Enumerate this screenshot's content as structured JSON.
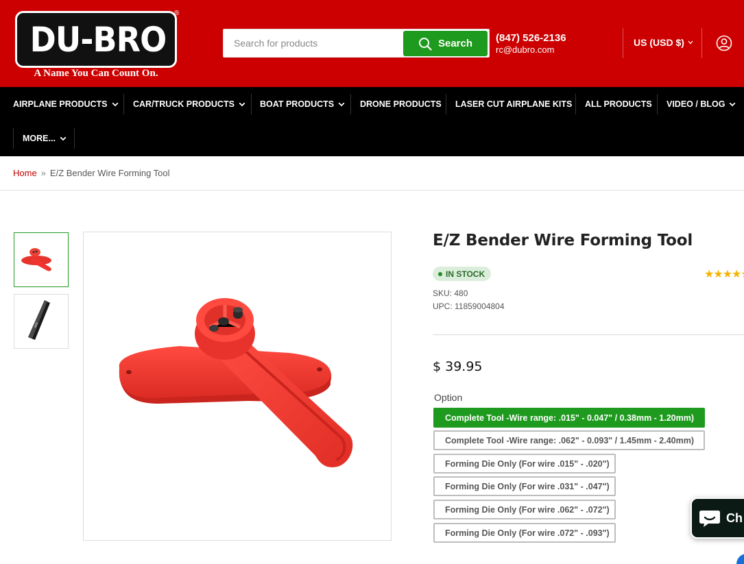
{
  "brand": {
    "logo_text": "DU-BRO",
    "registered": "®",
    "tagline": "A Name You Can Count On."
  },
  "search": {
    "placeholder": "Search for products",
    "button_label": "Search"
  },
  "contact": {
    "phone": "(847) 526-2136",
    "email": "rc@dubro.com"
  },
  "currency": {
    "label": "US (USD $)"
  },
  "nav": {
    "items": [
      {
        "label": "AIRPLANE PRODUCTS"
      },
      {
        "label": "CAR/TRUCK PRODUCTS"
      },
      {
        "label": "BOAT PRODUCTS"
      },
      {
        "label": "DRONE PRODUCTS"
      },
      {
        "label": "LASER CUT AIRPLANE KITS"
      },
      {
        "label": "ALL PRODUCTS"
      },
      {
        "label": "VIDEO / BLOG"
      },
      {
        "label": "MORE..."
      }
    ]
  },
  "breadcrumb": {
    "home": "Home",
    "separator": "»",
    "current": "E/Z Bender Wire Forming Tool"
  },
  "product": {
    "title": "E/Z Bender Wire Forming Tool",
    "stock": "IN STOCK",
    "stars": "★★★★★",
    "sku": "SKU: 480",
    "upc": "UPC: 11859004804",
    "price": "$ 39.95",
    "option_label": "Option",
    "options": [
      {
        "label": "Complete Tool -Wire range: .015\" - 0.047\" / 0.38mm - 1.20mm)",
        "selected": true
      },
      {
        "label": "Complete Tool -Wire range: .062\" - 0.093\" / 1.45mm - 2.40mm)",
        "selected": false
      },
      {
        "label": "Forming Die Only (For wire .015\" - .020\")",
        "selected": false
      },
      {
        "label": "Forming Die Only (For wire .031\" - .047\")",
        "selected": false
      },
      {
        "label": "Forming Die Only (For wire .062\" - .072\")",
        "selected": false
      },
      {
        "label": "Forming Die Only (For wire .072\" - .093\")",
        "selected": false
      }
    ]
  },
  "chat": {
    "label": "Ch"
  },
  "colors": {
    "header_red": "#cc0000",
    "nav_black": "#000000",
    "accent_green": "#1e9a1e",
    "product_red": "#f0352f",
    "star_gold": "#f4b400"
  }
}
